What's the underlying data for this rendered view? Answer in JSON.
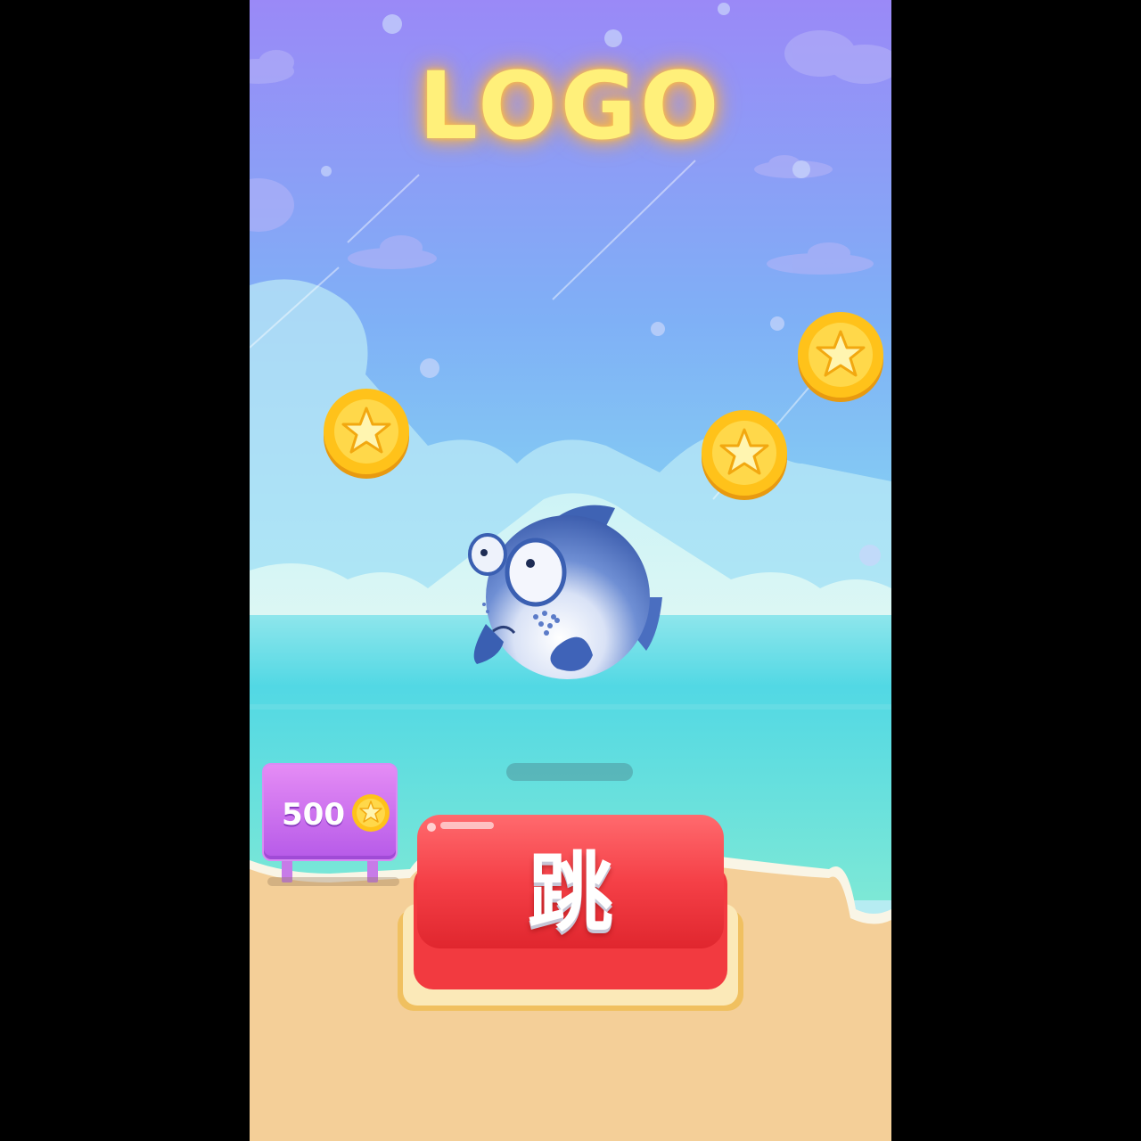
{
  "game": {
    "logo_text": "LOGO",
    "jump_button_label": "跳",
    "coin_balance": "500"
  },
  "icons": {
    "coin": "star-coin-icon",
    "character": "pufferfish"
  },
  "colors": {
    "sky_top": "#9b8cf8",
    "sky_mid": "#7ec0f6",
    "sea": "#5fd8e6",
    "sand": "#f6d3a0",
    "button_red": "#f03a40",
    "sign_purple": "#c26cef",
    "logo_yellow": "#fff07a",
    "coin_gold": "#ffc21a"
  }
}
